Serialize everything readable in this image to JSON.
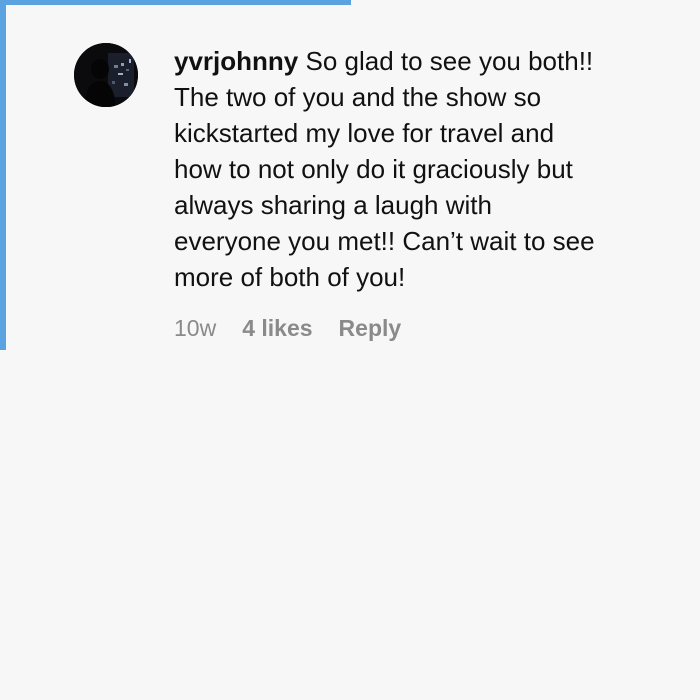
{
  "comment": {
    "username": "yvrjohnny",
    "text": "So glad to see you both!! The two of you and the show so kickstarted my love for travel and how to not only do it graciously but always sharing a laugh with everyone you met!! Can’t wait to see more of both of you!",
    "timestamp": "10w",
    "likes_label": "4 likes",
    "reply_label": "Reply"
  },
  "colors": {
    "background": "#f7f7f7",
    "highlight": "#5aa2e0",
    "text": "#111111",
    "meta_text": "#8a8a8a"
  }
}
